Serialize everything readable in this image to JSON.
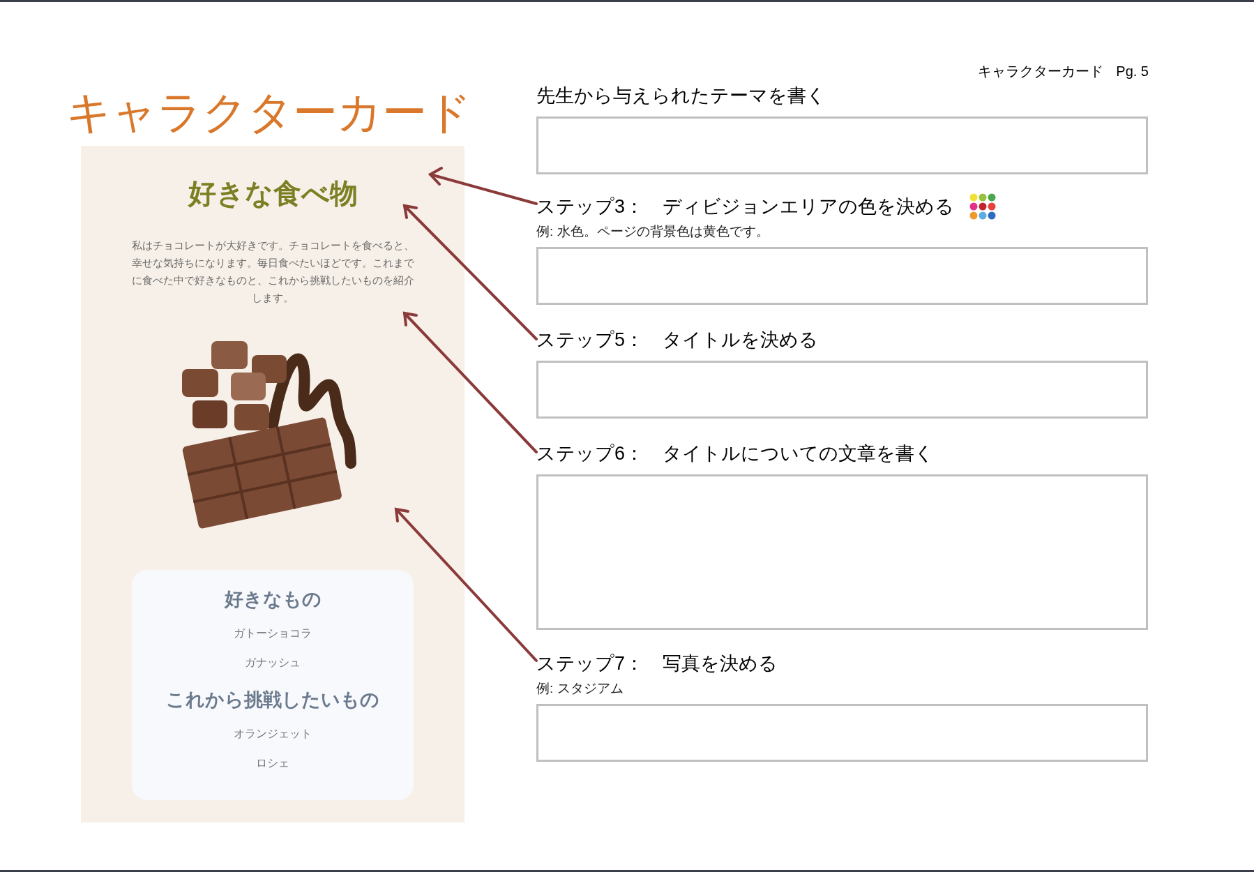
{
  "header": {
    "title": "キャラクターカード",
    "page": "Pg. 5"
  },
  "card_title": "キャラクターカード",
  "card": {
    "heading": "好きな食べ物",
    "description": "私はチョコレートが大好きです。チョコレートを食べると、幸せな気持ちになります。毎日食べたいほどです。これまでに食べた中で好きなものと、これから挑戦したいものを紹介します。",
    "sections": [
      {
        "heading": "好きなもの",
        "items": [
          "ガトーショコラ",
          "ガナッシュ"
        ]
      },
      {
        "heading": "これから挑戦したいもの",
        "items": [
          "オランジェット",
          "ロシェ"
        ]
      }
    ]
  },
  "steps": [
    {
      "kind": "field",
      "label": "先生から与えられたテーマを書く"
    },
    {
      "kind": "color-field",
      "label": "ステップ3：　ディビジョンエリアの色を決める",
      "example": "例: 水色。ページの背景色は黄色です。"
    },
    {
      "kind": "field",
      "label": "ステップ5：　タイトルを決める"
    },
    {
      "kind": "text-area",
      "label": "ステップ6：　タイトルについての文章を書く"
    },
    {
      "kind": "field",
      "label": "ステップ7：　写真を決める",
      "example": "例: スタジアム"
    }
  ]
}
